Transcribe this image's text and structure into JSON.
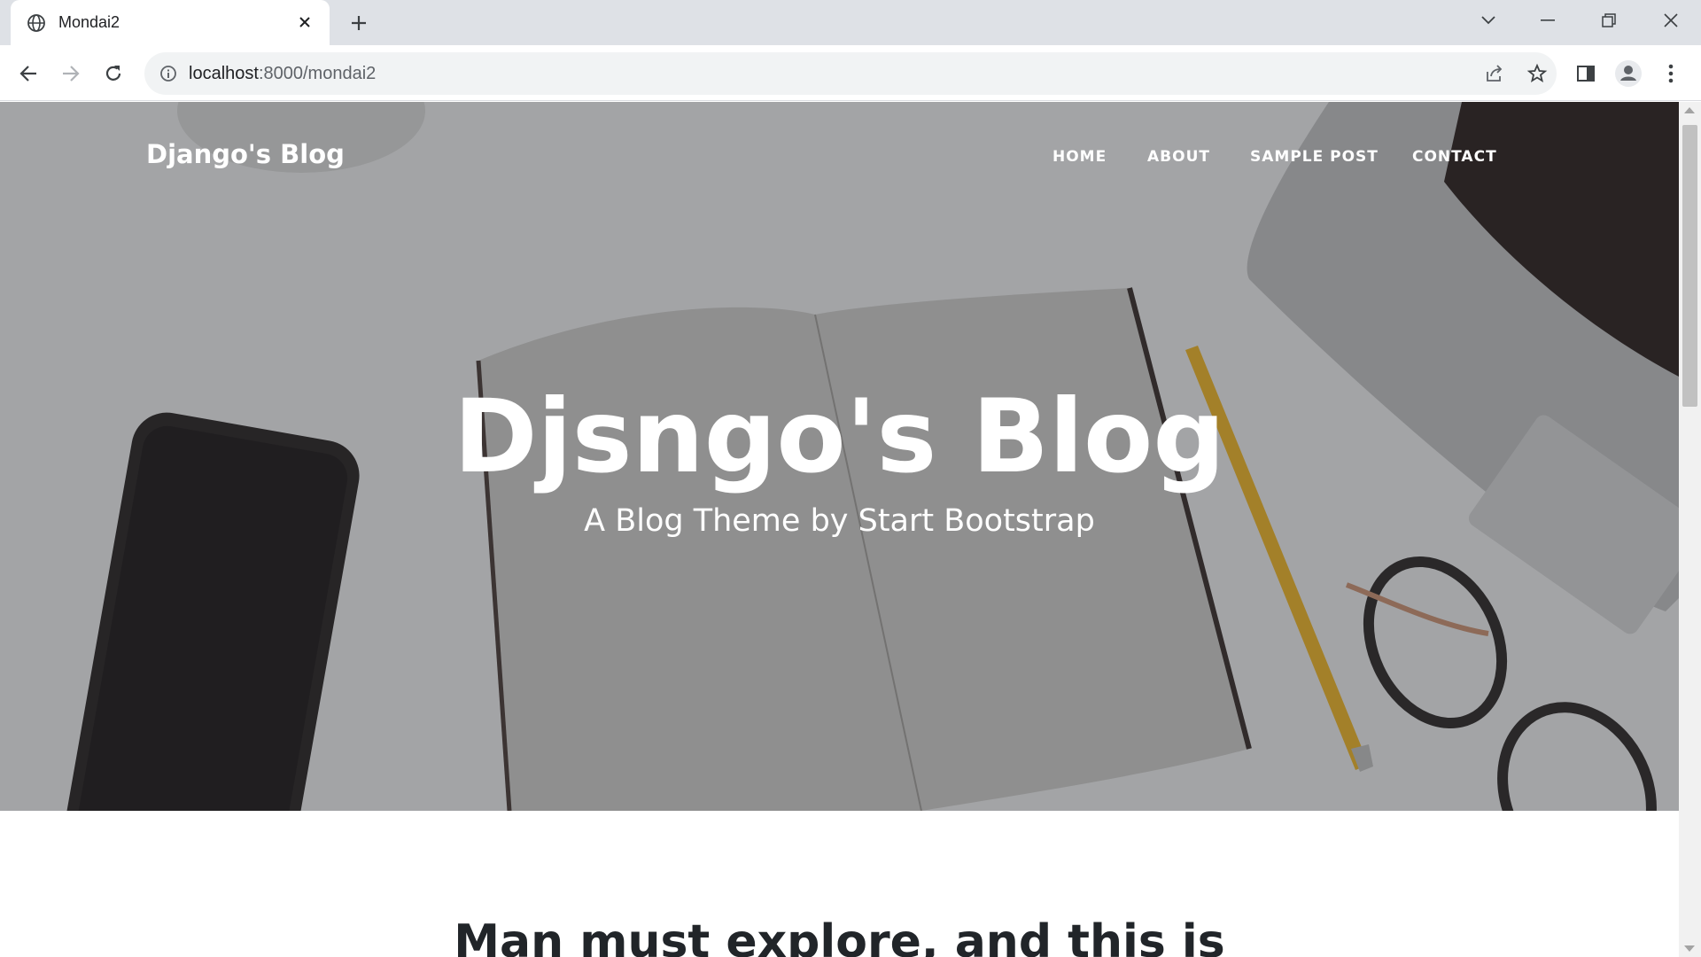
{
  "browser": {
    "tab_title": "Mondai2",
    "url_host": "localhost",
    "url_path": ":8000/mondai2"
  },
  "site": {
    "brand": "Django's Blog",
    "nav": [
      "HOME",
      "ABOUT",
      "SAMPLE POST",
      "CONTACT"
    ],
    "heading": "Djsngo's Blog",
    "subheading": "A Blog Theme by Start Bootstrap",
    "first_post_title": "Man must explore, and this is"
  },
  "colors": {
    "hero_overlay": "#212529",
    "text_dark": "#212529",
    "chrome_tabstrip": "#dee1e6"
  },
  "icons": [
    "globe-icon",
    "close-icon",
    "plus-icon",
    "chevron-down-icon",
    "minimize-icon",
    "restore-icon",
    "close-window-icon",
    "back-icon",
    "forward-icon",
    "reload-icon",
    "info-icon",
    "share-icon",
    "star-icon",
    "side-panel-icon",
    "profile-icon",
    "kebab-menu-icon"
  ]
}
